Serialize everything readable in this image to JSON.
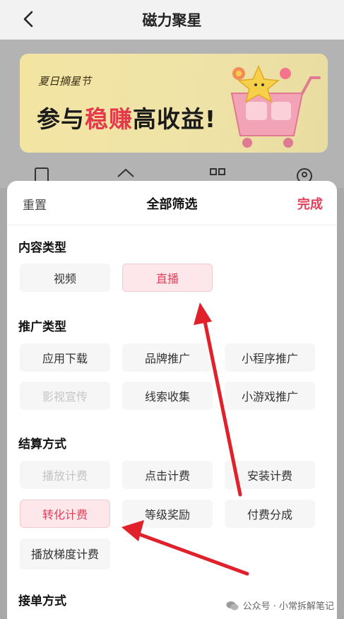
{
  "topbar": {
    "title": "磁力聚星",
    "back_icon": "chevron-left-icon"
  },
  "banner": {
    "script": "夏日摘星节",
    "headline_pre": "参与",
    "headline_hl": "稳赚",
    "headline_post": "高收益!",
    "accent": "#e23a4a"
  },
  "sheet": {
    "reset_label": "重置",
    "title": "全部筛选",
    "done_label": "完成",
    "accent": "#e2405a"
  },
  "sections": {
    "content_type": {
      "title": "内容类型",
      "options": [
        "视频",
        "直播"
      ]
    },
    "promo_type": {
      "title": "推广类型",
      "options": [
        "应用下载",
        "品牌推广",
        "小程序推广",
        "影视宣传",
        "线索收集",
        "小游戏推广"
      ]
    },
    "settlement": {
      "title": "结算方式",
      "options": [
        "播放计费",
        "点击计费",
        "安装计费",
        "转化计费",
        "等级奖励",
        "付费分成",
        "播放梯度计费"
      ]
    },
    "order_method": {
      "title": "接单方式"
    }
  },
  "selected": [
    "直播",
    "转化计费"
  ],
  "disabled": [
    "影视宣传",
    "播放计费"
  ],
  "watermark": "公众号 · 小常拆解笔记"
}
